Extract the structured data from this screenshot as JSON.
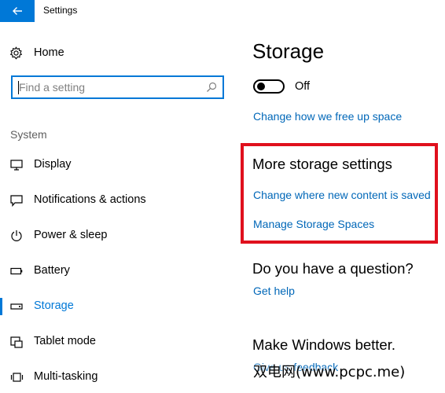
{
  "window": {
    "title": "Settings"
  },
  "sidebar": {
    "home_label": "Home",
    "search_placeholder": "Find a setting",
    "section_label": "System",
    "items": [
      {
        "label": "Display",
        "icon": "monitor-icon",
        "active": false
      },
      {
        "label": "Notifications & actions",
        "icon": "notification-icon",
        "active": false
      },
      {
        "label": "Power & sleep",
        "icon": "power-icon",
        "active": false
      },
      {
        "label": "Battery",
        "icon": "battery-icon",
        "active": false
      },
      {
        "label": "Storage",
        "icon": "storage-icon",
        "active": true
      },
      {
        "label": "Tablet mode",
        "icon": "tablet-mode-icon",
        "active": false
      },
      {
        "label": "Multi-tasking",
        "icon": "multitasking-icon",
        "active": false
      }
    ]
  },
  "main": {
    "title": "Storage",
    "storage_sense": {
      "state_label": "Off",
      "on": false
    },
    "free_space_link": "Change how we free up space",
    "more_settings": {
      "heading": "More storage settings",
      "links": [
        "Change where new content is saved",
        "Manage Storage Spaces"
      ]
    },
    "question": {
      "heading": "Do you have a question?",
      "link": "Get help"
    },
    "feedback": {
      "heading": "Make Windows better.",
      "link": "Give us feedback"
    }
  },
  "watermark": "双电网(www.pcpc.me)",
  "colors": {
    "accent": "#0078d7",
    "link": "#0067b8",
    "highlight_box": "#e0101d"
  }
}
